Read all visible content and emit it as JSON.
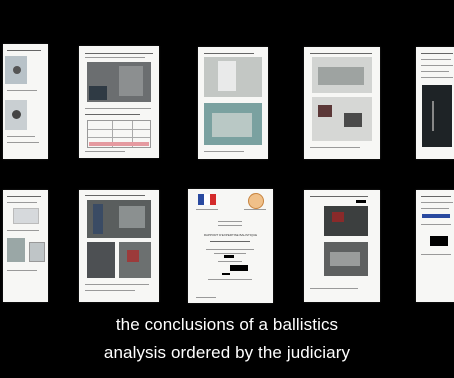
{
  "subtitle": {
    "line1": "the conclusions of a ballistics",
    "line2": "analysis ordered by the judiciary"
  },
  "report_cover": {
    "title": "RAPPORT D'EXPERTISE BALISTIQUE"
  }
}
